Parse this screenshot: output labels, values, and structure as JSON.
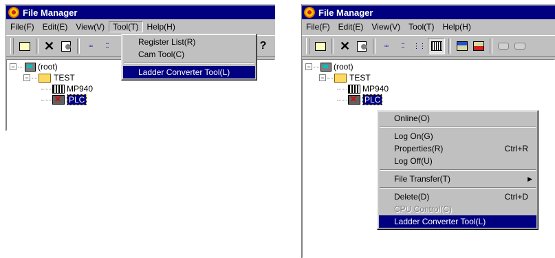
{
  "left_window": {
    "title": "File Manager",
    "menu": [
      "File(F)",
      "Edit(E)",
      "View(V)",
      "Tool(T)",
      "Help(H)"
    ],
    "tool_dropdown": {
      "items": [
        "Register List(R)",
        "Cam Tool(C)"
      ],
      "highlighted": "Ladder Converter Tool(L)"
    },
    "tree": {
      "root": "(root)",
      "folder": "TEST",
      "module": "MP940",
      "plc": "PLC"
    }
  },
  "right_window": {
    "title": "File Manager",
    "menu": [
      "File(F)",
      "Edit(E)",
      "View(V)",
      "Tool(T)",
      "Help(H)"
    ],
    "tree": {
      "root": "(root)",
      "folder": "TEST",
      "module": "MP940",
      "plc": "PLC"
    },
    "context_menu": {
      "online": "Online(O)",
      "log_on": "Log On(G)",
      "properties": "Properties(R)",
      "properties_shortcut": "Ctrl+R",
      "log_off": "Log Off(U)",
      "file_transfer": "File Transfer(T)",
      "delete": "Delete(D)",
      "delete_shortcut": "Ctrl+D",
      "cpu_control": "CPU Control(C)",
      "ladder": "Ladder Converter Tool(L)"
    }
  },
  "icons": [
    "open-folder-icon",
    "delete-icon",
    "properties-icon",
    "tree-view-icon",
    "list-view-icon",
    "details-view-icon",
    "table-view-icon",
    "download-icon",
    "upload-icon",
    "disabled-tool-icon",
    "help-icon",
    "computer-icon",
    "folder-icon",
    "module-icon",
    "plc-icon",
    "submenu-arrow-icon"
  ],
  "colors": {
    "title_bar": "#000080",
    "selection": "#000080",
    "chrome": "#c0c0c0"
  }
}
